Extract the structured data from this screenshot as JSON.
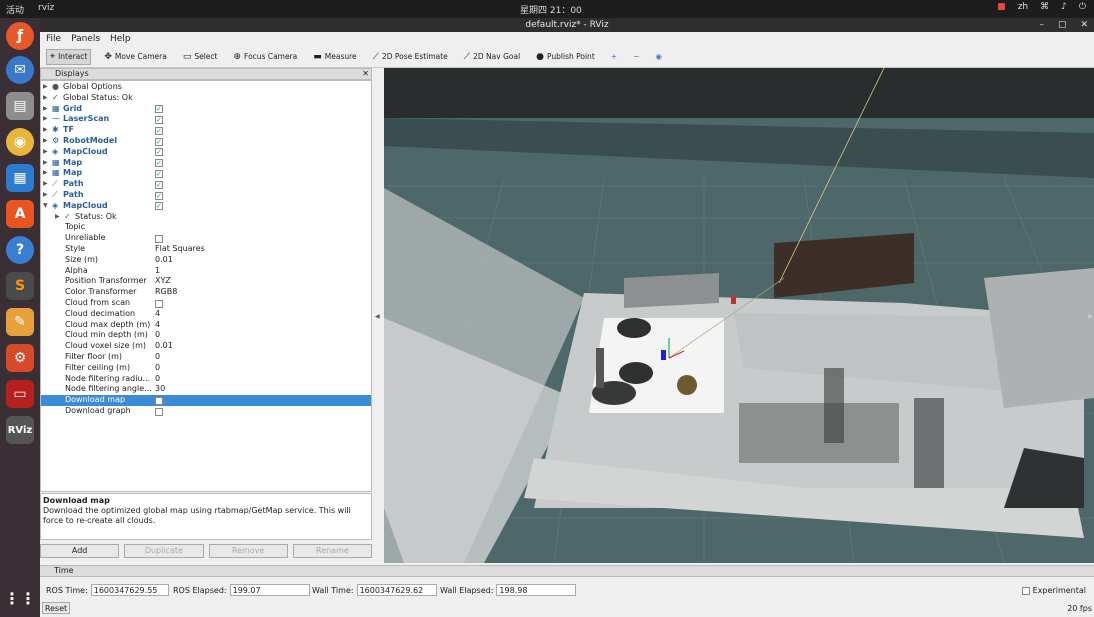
{
  "topbar": {
    "activities": "活动",
    "app": "rviz",
    "clock": "星期四 21：00",
    "lang": "zh"
  },
  "window": {
    "title": "default.rviz* - RViz"
  },
  "menu": [
    "File",
    "Panels",
    "Help"
  ],
  "toolbar": [
    {
      "label": "Interact",
      "icon": "cursor-icon",
      "glyph": "⌖",
      "active": true
    },
    {
      "label": "Move Camera",
      "icon": "move-camera-icon",
      "glyph": "✥"
    },
    {
      "label": "Select",
      "icon": "select-icon",
      "glyph": "▭"
    },
    {
      "label": "Focus Camera",
      "icon": "focus-camera-icon",
      "glyph": "⊕"
    },
    {
      "label": "Measure",
      "icon": "measure-icon",
      "glyph": "▬"
    },
    {
      "label": "2D Pose Estimate",
      "icon": "pose-estimate-icon",
      "glyph": "⟋"
    },
    {
      "label": "2D Nav Goal",
      "icon": "nav-goal-icon",
      "glyph": "⟋"
    },
    {
      "label": "Publish Point",
      "icon": "publish-point-icon",
      "glyph": "●"
    }
  ],
  "displays": {
    "title": "Displays",
    "rows": [
      {
        "name": "Global Options",
        "indent": 0,
        "expander": "▶",
        "icon": "●"
      },
      {
        "name": "Global Status: Ok",
        "indent": 0,
        "expander": "▶",
        "icon": "✓"
      },
      {
        "name": "Grid",
        "indent": 0,
        "expander": "▶",
        "icon": "▦",
        "bold": true,
        "check": true
      },
      {
        "name": "LaserScan",
        "indent": 0,
        "expander": "▶",
        "icon": "⁓",
        "bold": true,
        "check": true
      },
      {
        "name": "TF",
        "indent": 0,
        "expander": "▶",
        "icon": "✱",
        "bold": true,
        "check": true
      },
      {
        "name": "RobotModel",
        "indent": 0,
        "expander": "▶",
        "icon": "⚙",
        "bold": true,
        "check": true
      },
      {
        "name": "MapCloud",
        "indent": 0,
        "expander": "▶",
        "icon": "◈",
        "bold": true,
        "check": true
      },
      {
        "name": "Map",
        "indent": 0,
        "expander": "▶",
        "icon": "▦",
        "bold": true,
        "check": true
      },
      {
        "name": "Map",
        "indent": 0,
        "expander": "▶",
        "icon": "▦",
        "bold": true,
        "check": true
      },
      {
        "name": "Path",
        "indent": 0,
        "expander": "▶",
        "icon": "⟋",
        "bold": true,
        "check": true
      },
      {
        "name": "Path",
        "indent": 0,
        "expander": "▶",
        "icon": "⟋",
        "bold": true,
        "check": true
      },
      {
        "name": "MapCloud",
        "indent": 0,
        "expander": "▼",
        "icon": "◈",
        "bold": true,
        "check": true
      },
      {
        "name": "Status: Ok",
        "indent": 1,
        "expander": "▶",
        "icon": "✓"
      },
      {
        "name": "Topic",
        "indent": 1,
        "value": ""
      },
      {
        "name": "Unreliable",
        "indent": 1,
        "check": false
      },
      {
        "name": "Style",
        "indent": 1,
        "value": "Flat Squares"
      },
      {
        "name": "Size (m)",
        "indent": 1,
        "value": "0.01"
      },
      {
        "name": "Alpha",
        "indent": 1,
        "value": "1"
      },
      {
        "name": "Position Transformer",
        "indent": 1,
        "value": "XYZ"
      },
      {
        "name": "Color Transformer",
        "indent": 1,
        "value": "RGB8"
      },
      {
        "name": "Cloud from scan",
        "indent": 1,
        "check": false
      },
      {
        "name": "Cloud decimation",
        "indent": 1,
        "value": "4"
      },
      {
        "name": "Cloud max depth (m)",
        "indent": 1,
        "value": "4"
      },
      {
        "name": "Cloud min depth (m)",
        "indent": 1,
        "value": "0"
      },
      {
        "name": "Cloud voxel size (m)",
        "indent": 1,
        "value": "0.01"
      },
      {
        "name": "Filter floor (m)",
        "indent": 1,
        "value": "0"
      },
      {
        "name": "Filter ceiling (m)",
        "indent": 1,
        "value": "0"
      },
      {
        "name": "Node filtering radiu...",
        "indent": 1,
        "value": "0"
      },
      {
        "name": "Node filtering angle...",
        "indent": 1,
        "value": "30"
      },
      {
        "name": "Download map",
        "indent": 1,
        "check": false,
        "selected": true
      },
      {
        "name": "Download graph",
        "indent": 1,
        "check": false
      }
    ],
    "description_title": "Download map",
    "description": "Download the optimized global map using rtabmap/GetMap service. This will force to re-create all clouds.",
    "buttons": {
      "add": "Add",
      "duplicate": "Duplicate",
      "remove": "Remove",
      "rename": "Rename"
    }
  },
  "time": {
    "title": "Time",
    "ros_time_label": "ROS Time:",
    "ros_time": "1600347629.55",
    "ros_elapsed_label": "ROS Elapsed:",
    "ros_elapsed": "199.07",
    "wall_time_label": "Wall Time:",
    "wall_time": "1600347629.62",
    "wall_elapsed_label": "Wall Elapsed:",
    "wall_elapsed": "198.98",
    "experimental": "Experimental",
    "reset": "Reset",
    "fps": "20 fps"
  },
  "colors": {
    "accent": "#3c8bd7",
    "viewport_bg": "#4e6869",
    "floor": "#c9cccc",
    "titlebar": "#2e2e2e"
  }
}
